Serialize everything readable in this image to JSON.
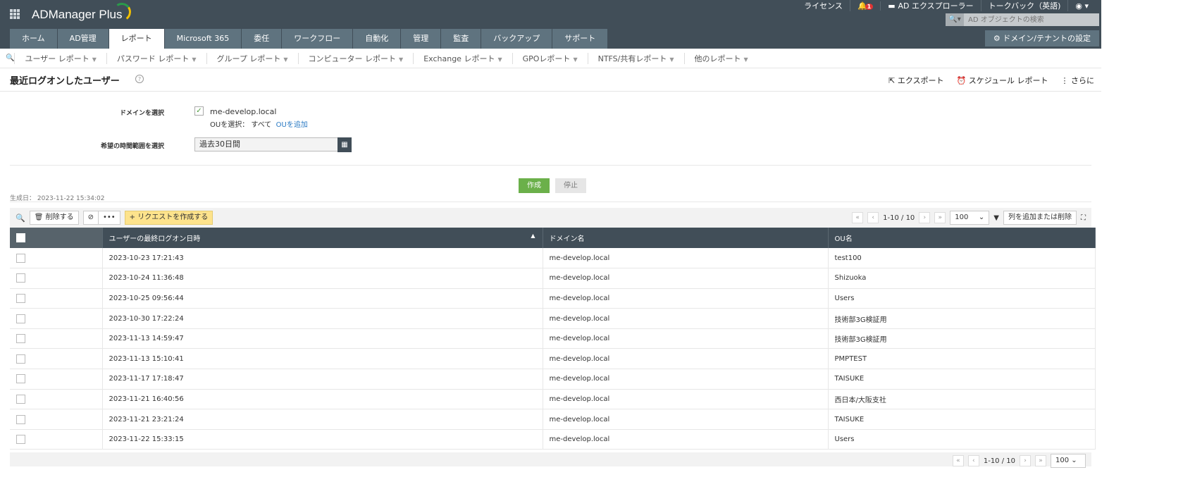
{
  "app": {
    "name": "ADManager Plus",
    "license": "ライセンス",
    "notif_count": "1",
    "explorer": "AD エクスプローラー",
    "talkback": "トークバック（英語)",
    "search_placeholder": "AD オブジェクトの検索",
    "domain_settings": "ドメイン/テナントの設定"
  },
  "tabs": [
    "ホーム",
    "AD管理",
    "レポート",
    "Microsoft 365",
    "委任",
    "ワークフロー",
    "自動化",
    "管理",
    "監査",
    "バックアップ",
    "サポート"
  ],
  "subnav": [
    "ユーザー レポート",
    "パスワード レポート",
    "グループ レポート",
    "コンピューター レポート",
    "Exchange レポート",
    "GPOレポート",
    "NTFS/共有レポート",
    "他のレポート"
  ],
  "page": {
    "title": "最近ログオンしたユーザー",
    "export": "エクスポート",
    "schedule": "スケジュール レポート",
    "more": "さらに"
  },
  "form": {
    "domain_label": "ドメインを選択",
    "domain": "me-develop.local",
    "ou_label": "OUを選択：",
    "ou_value": "すべて",
    "ou_add": "OUを追加",
    "period_label": "希望の時間範囲を選択",
    "period": "過去30日間",
    "generate": "作成",
    "stop": "停止",
    "generated": "生成日： 2023-11-22 15:34:02"
  },
  "toolbar": {
    "delete": "削除する",
    "more": "•••",
    "request": "リクエストを作成する",
    "range": "1-10 / 10",
    "page_size": "100",
    "columns": "列を追加または削除"
  },
  "table": {
    "headers": [
      "ユーザーの最終ログオン日時",
      "ドメイン名",
      "OU名"
    ],
    "rows": [
      [
        "2023-10-23 17:21:43",
        "me-develop.local",
        "test100"
      ],
      [
        "2023-10-24 11:36:48",
        "me-develop.local",
        "Shizuoka"
      ],
      [
        "2023-10-25 09:56:44",
        "me-develop.local",
        "Users"
      ],
      [
        "2023-10-30 17:22:24",
        "me-develop.local",
        "技術部3G検証用"
      ],
      [
        "2023-11-13 14:59:47",
        "me-develop.local",
        "技術部3G検証用"
      ],
      [
        "2023-11-13 15:10:41",
        "me-develop.local",
        "PMPTEST"
      ],
      [
        "2023-11-17 17:18:47",
        "me-develop.local",
        "TAISUKE"
      ],
      [
        "2023-11-21 16:40:56",
        "me-develop.local",
        "西日本/大阪支社"
      ],
      [
        "2023-11-21 23:21:24",
        "me-develop.local",
        "TAISUKE"
      ],
      [
        "2023-11-22 15:33:15",
        "me-develop.local",
        "Users"
      ]
    ]
  }
}
